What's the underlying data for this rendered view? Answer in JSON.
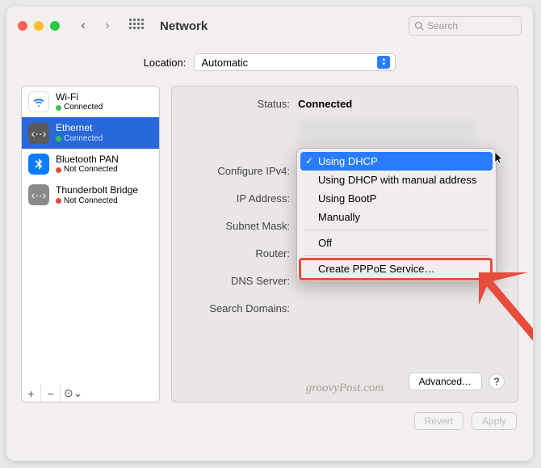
{
  "window": {
    "title": "Network",
    "search_placeholder": "Search"
  },
  "location": {
    "label": "Location:",
    "value": "Automatic"
  },
  "services": [
    {
      "name": "Wi-Fi",
      "status": "Connected",
      "dot": "green",
      "iconClass": "wifi-icon",
      "glyph": "᯾"
    },
    {
      "name": "Ethernet",
      "status": "Connected",
      "dot": "green",
      "iconClass": "eth-icon",
      "glyph": "‹··›"
    },
    {
      "name": "Bluetooth PAN",
      "status": "Not Connected",
      "dot": "red",
      "iconClass": "bt-icon",
      "glyph": "⌔"
    },
    {
      "name": "Thunderbolt Bridge",
      "status": "Not Connected",
      "dot": "red",
      "iconClass": "tb-icon",
      "glyph": "‹··›"
    }
  ],
  "sidebar_controls": {
    "add": "+",
    "remove": "−",
    "menu": "⊙⌄"
  },
  "main": {
    "status_label": "Status:",
    "status_value": "Connected",
    "fields": {
      "configure_ipv4": "Configure IPv4:",
      "ip_address": "IP Address:",
      "subnet_mask": "Subnet Mask:",
      "router": "Router:",
      "dns_server": "DNS Server:",
      "search_domains": "Search Domains:"
    },
    "advanced": "Advanced…",
    "help": "?"
  },
  "dropdown": {
    "options": [
      "Using DHCP",
      "Using DHCP with manual address",
      "Using BootP",
      "Manually",
      "Off",
      "Create PPPoE Service…"
    ]
  },
  "footer": {
    "revert": "Revert",
    "apply": "Apply"
  },
  "watermark": "groovyPost.com"
}
